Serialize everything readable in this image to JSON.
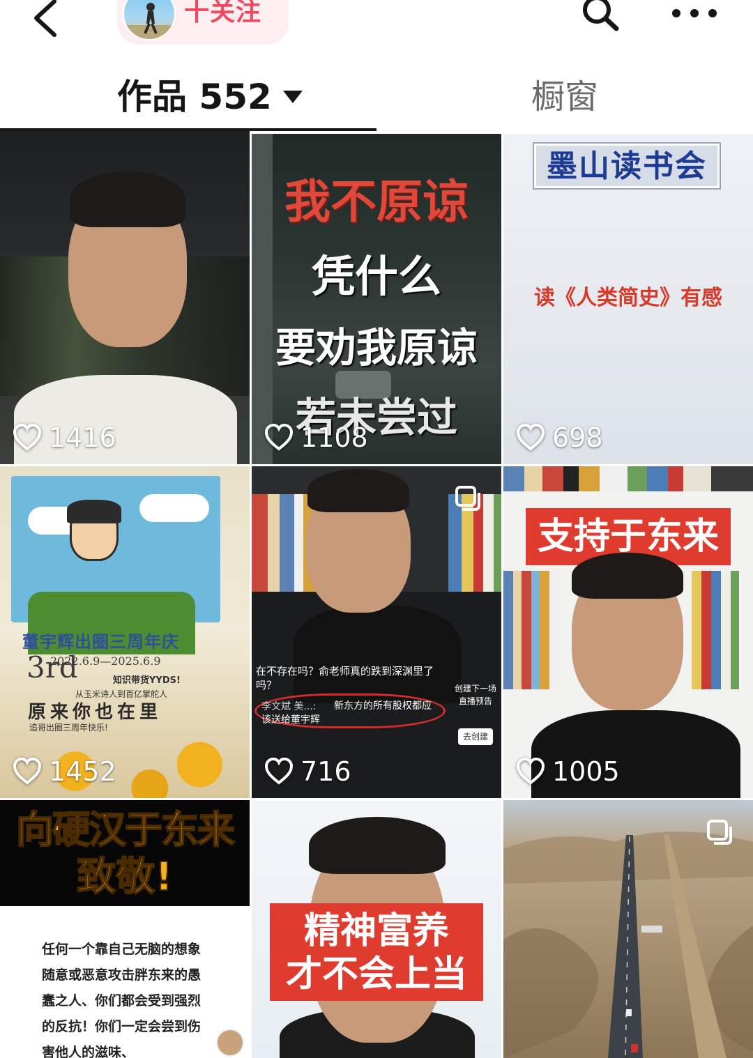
{
  "header": {
    "back_icon": "chevron-left-icon",
    "follow_label": "十关注",
    "search_icon": "search-icon",
    "more_icon": "more-dots-icon"
  },
  "tabs": {
    "works_label": "作品 552",
    "shop_label": "橱窗"
  },
  "videos": [
    {
      "likes": "1416"
    },
    {
      "likes": "1108",
      "lines": [
        "我不原谅",
        "凭什么",
        "要劝我原谅",
        "若未尝过"
      ]
    },
    {
      "likes": "698",
      "badge": "墨山读书会",
      "subtitle": "读《人类简史》有感"
    },
    {
      "likes": "1452",
      "title": "董宇辉出圈三周年庆",
      "big": "3rd",
      "dates": "2022.6.9—2025.6.9",
      "tag": "知识带货YYDS!",
      "sub": "从玉米诗人到百亿掌舵人",
      "slogan": "原来你也在里",
      "footer": "追哥出圈三周年快乐!"
    },
    {
      "likes": "716",
      "comment_top": "在不存在吗？俞老师真的跌到深渊里了吗？",
      "comment_name": "李文斌 美...:",
      "comment_text": "新东方的所有股权都应该送给董宇辉",
      "side_title": "创建下一场直播预告",
      "side_btn": "去创建"
    },
    {
      "likes": "1005",
      "banner": "支持于东来"
    },
    {
      "title_line1": "向硬汉于东来",
      "title_line2": "致敬!",
      "body": "任何一个靠自己无脑的想象随意或恶意攻击胖东来的愚蠢之人、你们都会受到强烈的反抗！你们一定会尝到伤害他人的滋味、"
    },
    {
      "banner_line1": "精神富养",
      "banner_line2": "才不会上当"
    },
    {
      "scene": "desert-road"
    }
  ],
  "colors": {
    "accent": "#f2485d",
    "banner_red": "#e03b2f",
    "caption_red": "#d83a2a"
  }
}
